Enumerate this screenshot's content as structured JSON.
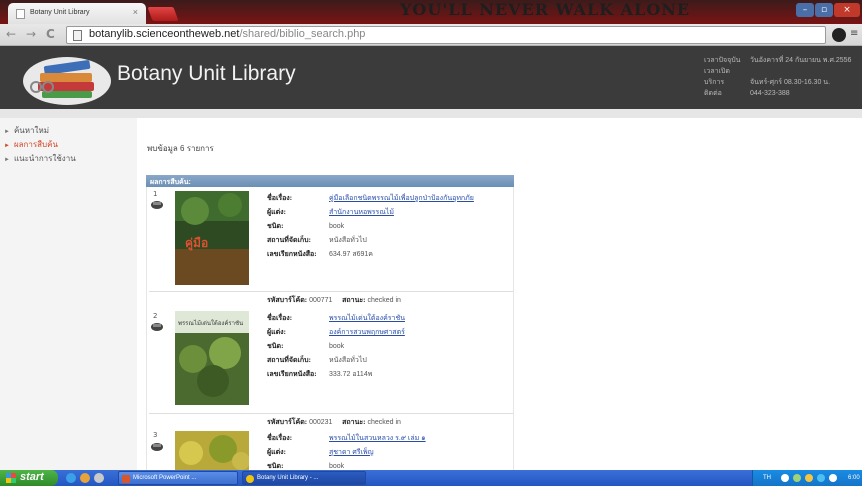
{
  "browser": {
    "tab_title": "Botany Unit Library",
    "page_slogan": "YOU'LL NEVER WALK ALONE",
    "url_host": "botanylib.scienceontheweb.net",
    "url_path": "/shared/biblio_search.php",
    "minimize_glyph": "–",
    "maximize_glyph": "▫",
    "close_glyph": "×",
    "back_glyph": "←",
    "forward_glyph": "→",
    "reload_glyph": "C",
    "star_glyph": "☆"
  },
  "header": {
    "site_title": "Botany Unit Library",
    "info": [
      {
        "label": "เวลาปัจจุบัน",
        "value": "วันอังคารที่ 24 กันยายน พ.ศ.2556"
      },
      {
        "label": "เวลาเปิดบริการ",
        "value": "จันทร์-ศุกร์ 08.30-16.30 น."
      },
      {
        "label": "ติดต่อ",
        "value": "044-323-388"
      }
    ]
  },
  "sidebar": {
    "items": [
      {
        "label": "ค้นหาใหม่",
        "active": false
      },
      {
        "label": "ผลการสืบค้น",
        "active": true
      },
      {
        "label": "แนะนำการใช้งาน",
        "active": false
      }
    ],
    "active_color": "#d04a2a"
  },
  "results": {
    "summary": "พบข้อมูล 6 รายการ",
    "bar_title": "ผลการสืบค้น:",
    "field_labels": {
      "title": "ชื่อเรื่อง:",
      "author": "ผู้แต่ง:",
      "type": "ชนิด:",
      "collection": "สถานที่จัดเก็บ:",
      "call_number": "เลขเรียกหนังสือ:",
      "barcode": "รหัสบาร์โค้ด:",
      "status": "สถานะ:"
    },
    "records": [
      {
        "num": "1",
        "title": "คู่มือเลือกชนิดพรรณไม้เพื่อปลูกป่าป้องกันอุทกภัย",
        "author": "สำนักงานหอพรรณไม้",
        "type": "book",
        "collection": "หนังสือทั่วไป",
        "call_number": "634.97 ส691ค",
        "barcode": "000771",
        "status": "checked in",
        "cover_text": "คู่มือ"
      },
      {
        "num": "2",
        "title": "พรรณไม้เด่นใต้องค์ราชัน",
        "author": "องค์การสวนพฤกษศาสตร์",
        "type": "book",
        "collection": "หนังสือทั่วไป",
        "call_number": "333.72 อ114พ",
        "barcode": "000231",
        "status": "checked in",
        "cover_text": "พรรณไม้เด่นใต้องค์ราชัน"
      },
      {
        "num": "3",
        "title": "พรรณไม้ในสวนหลวง ร.๙ เล่ม ๑",
        "author": "สุชาดา ศรีเพ็ญ",
        "type": "book"
      }
    ]
  },
  "taskbar": {
    "start_label": "start",
    "buttons": [
      {
        "label": "Microsoft PowerPoint ...",
        "active": false
      },
      {
        "label": "Botany Unit Library - ...",
        "active": true
      }
    ],
    "lang": "TH",
    "clock": "6:00"
  },
  "colors": {
    "header_bg": "#3b3b3b",
    "result_bar": "#7b9bc0",
    "link": "#2a4ea8",
    "browser_frame": "#7a1414"
  }
}
